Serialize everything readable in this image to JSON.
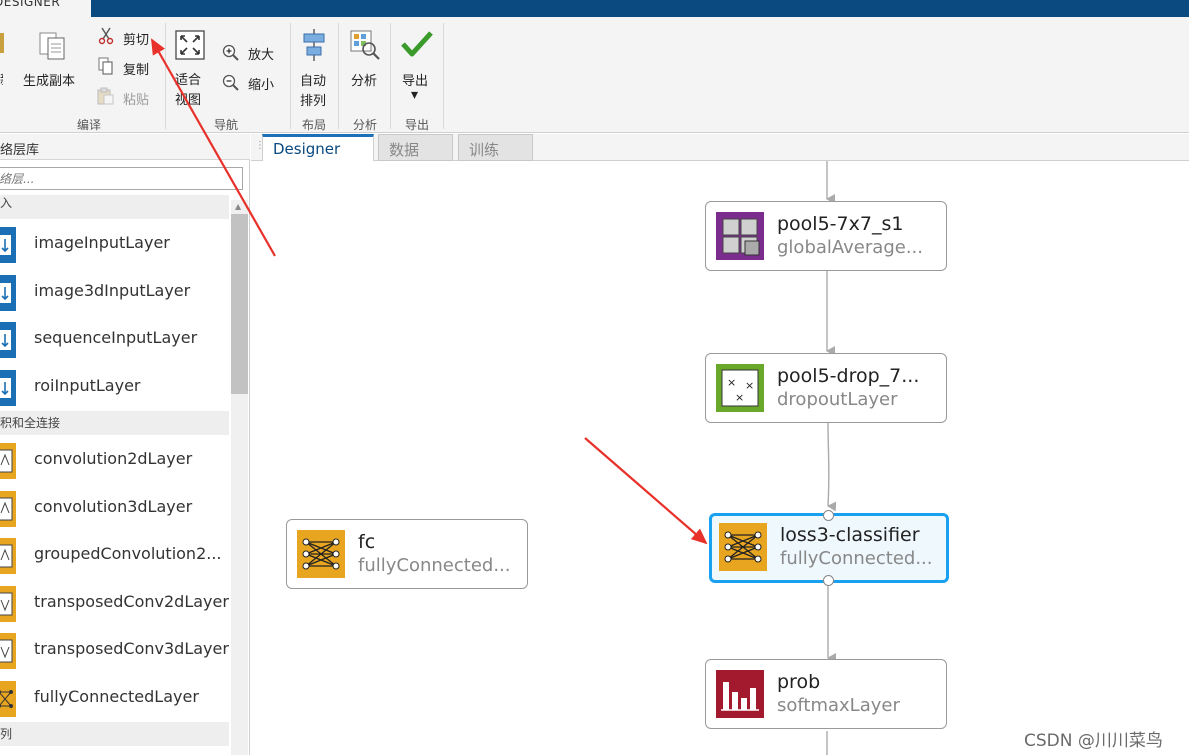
{
  "top_tab": {
    "label": "DESIGNER"
  },
  "ribbon": {
    "edit_group": {
      "label": "编译",
      "duplicate_label": "生成副本",
      "cut_label": "剪切",
      "copy_label": "复制",
      "paste_label": "粘贴"
    },
    "nav_group": {
      "label": "导航",
      "fit_label_line1": "适合",
      "fit_label_line2": "视图",
      "zoom_in_label": "放大",
      "zoom_out_label": "缩小"
    },
    "layout_group": {
      "label": "布局",
      "auto_arrange_line1": "自动",
      "auto_arrange_line2": "排列"
    },
    "analysis_group": {
      "label": "分析",
      "analyze_label": "分析"
    },
    "export_group": {
      "label": "导出",
      "export_label": "导出",
      "export_arrow": "▾"
    }
  },
  "library": {
    "title": "络层库",
    "search_placeholder": "络层...",
    "categories": [
      {
        "label": "入"
      },
      {
        "label": "积和全连接"
      },
      {
        "label": "列"
      }
    ],
    "input_layers": [
      {
        "name": "imageInputLayer"
      },
      {
        "name": "image3dInputLayer"
      },
      {
        "name": "sequenceInputLayer"
      },
      {
        "name": "roiInputLayer"
      }
    ],
    "conv_layers": [
      {
        "name": "convolution2dLayer"
      },
      {
        "name": "convolution3dLayer"
      },
      {
        "name": "groupedConvolution2..."
      },
      {
        "name": "transposedConv2dLayer"
      },
      {
        "name": "transposedConv3dLayer"
      },
      {
        "name": "fullyConnectedLayer"
      }
    ]
  },
  "canvas_tabs": [
    {
      "label": "Designer"
    },
    {
      "label": "数据"
    },
    {
      "label": "训练"
    }
  ],
  "nodes": {
    "pool5": {
      "title": "pool5-7x7_s1",
      "subtitle": "globalAverage...",
      "color": "#7b2d8e"
    },
    "drop": {
      "title": "pool5-drop_7...",
      "subtitle": "dropoutLayer",
      "color": "#6aa82a"
    },
    "loss3": {
      "title": "loss3-classifier",
      "subtitle": "fullyConnected...",
      "color": "#e8a520"
    },
    "fc": {
      "title": "fc",
      "subtitle": "fullyConnected...",
      "color": "#e8a520"
    },
    "prob": {
      "title": "prob",
      "subtitle": "softmaxLayer",
      "color": "#a3192e"
    }
  },
  "watermark": "CSDN @川川菜鸟",
  "colors": {
    "titlebar": "#0a4a80",
    "selection": "#1aa0f0",
    "annotation_arrow": "#e8312a"
  }
}
